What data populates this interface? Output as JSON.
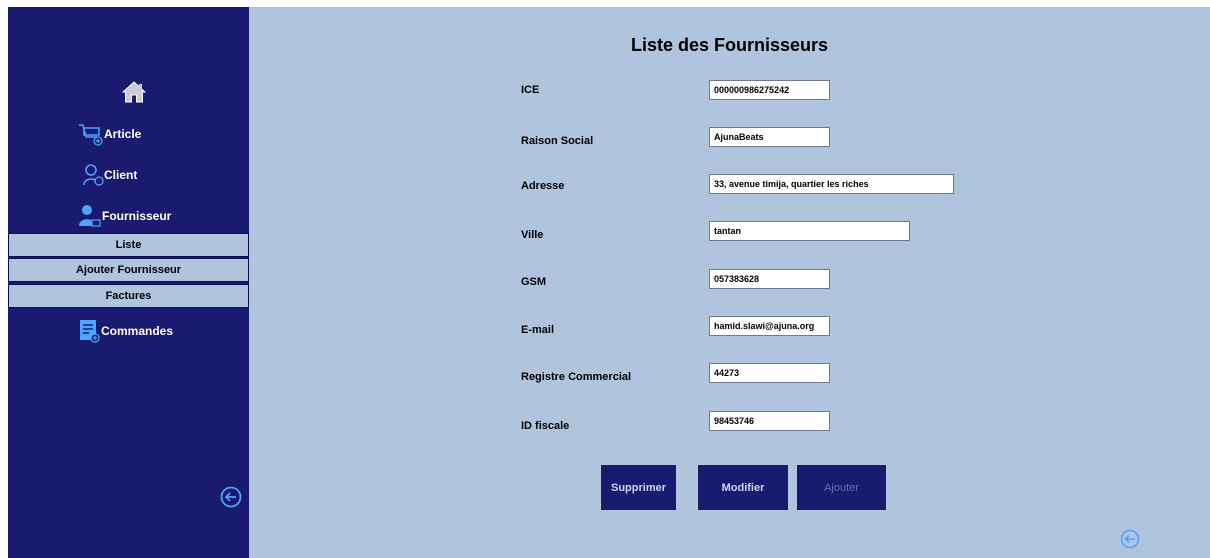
{
  "sidebar": {
    "home_icon": "home-icon",
    "items": [
      {
        "label": "Article",
        "icon": "cart-icon"
      },
      {
        "label": "Client",
        "icon": "user-outline-icon"
      },
      {
        "label": "Fournisseur",
        "icon": "user-solid-icon"
      },
      {
        "label": "Commandes",
        "icon": "document-add-icon"
      }
    ],
    "submenu": [
      {
        "label": "Liste"
      },
      {
        "label": "Ajouter Fournisseur"
      },
      {
        "label": "Factures"
      }
    ],
    "logout_icon": "arrow-left-circle-icon"
  },
  "main": {
    "title": "Liste des Fournisseurs",
    "fields": [
      {
        "label": "ICE",
        "value": "000000986275242"
      },
      {
        "label": "Raison Social",
        "value": "AjunaBeats"
      },
      {
        "label": "Adresse",
        "value": "33, avenue timija, quartier les riches"
      },
      {
        "label": "Ville",
        "value": "tantan"
      },
      {
        "label": "GSM",
        "value": "057383628"
      },
      {
        "label": "E-mail",
        "value": "hamid.slawi@ajuna.org"
      },
      {
        "label": "Registre Commercial",
        "value": "44273"
      },
      {
        "label": "ID fiscale",
        "value": "98453746"
      }
    ],
    "buttons": [
      {
        "label": "Supprimer"
      },
      {
        "label": "Modifier"
      },
      {
        "label": "Ajouter"
      }
    ],
    "back_icon": "arrow-left-circle-icon"
  },
  "colors": {
    "sidebar_bg": "#1a1a6e",
    "main_bg": "#b0c4de",
    "icon_blue": "#4da3ff"
  }
}
